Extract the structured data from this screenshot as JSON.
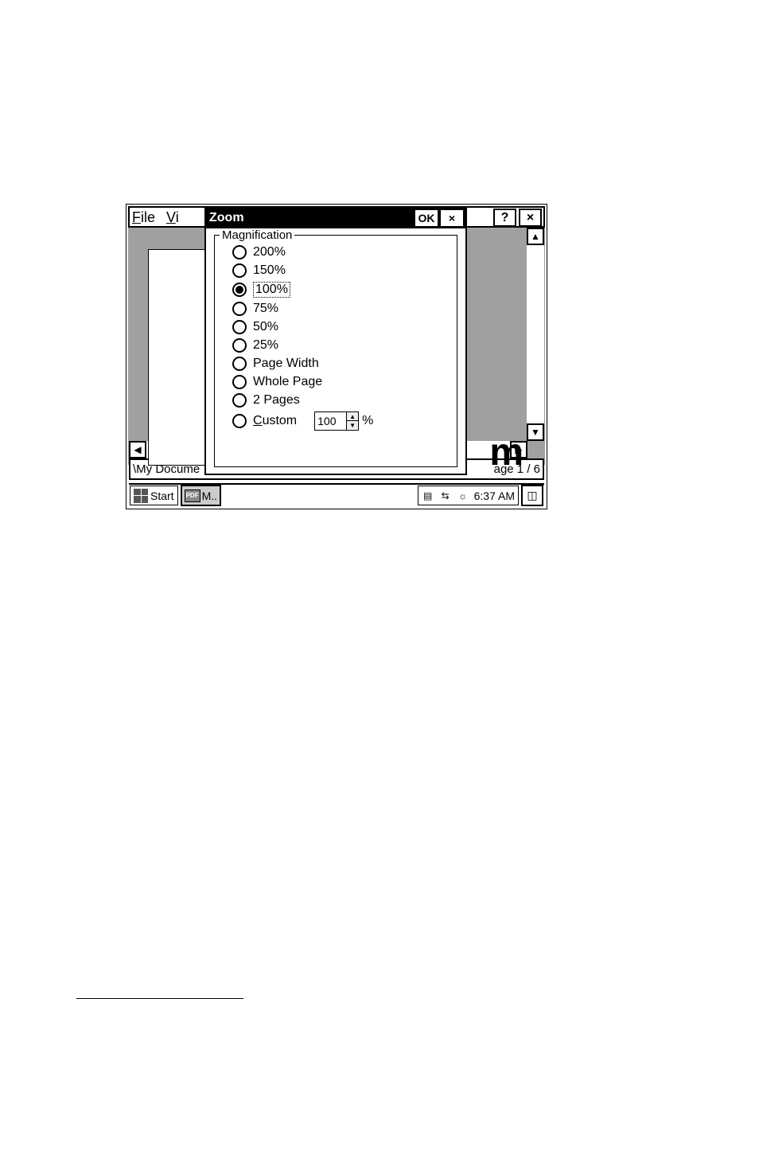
{
  "menu": {
    "file": "File",
    "view_partial": "Vi"
  },
  "title_buttons": {
    "help": "?",
    "close": "×"
  },
  "zoom": {
    "title": "Zoom",
    "ok": "OK",
    "close": "×",
    "legend": "Magnification",
    "options": [
      {
        "label": "200%",
        "selected": false
      },
      {
        "label": "150%",
        "selected": false
      },
      {
        "label": "100%",
        "selected": true
      },
      {
        "label": "75%",
        "selected": false
      },
      {
        "label": "50%",
        "selected": false
      },
      {
        "label": "25%",
        "selected": false
      },
      {
        "label": "Page Width",
        "selected": false
      },
      {
        "label": "Whole Page",
        "selected": false
      },
      {
        "label": "2 Pages",
        "selected": false
      }
    ],
    "custom_label": "Custom",
    "custom_value": "100",
    "custom_pct": "%"
  },
  "status": {
    "path": "\\My Docume",
    "page": "age 1 / 6"
  },
  "workspace": {
    "letter": "m"
  },
  "taskbar": {
    "start": "Start",
    "task1": "M..",
    "time": "6:37 AM",
    "pdf_badge": "PDF"
  }
}
